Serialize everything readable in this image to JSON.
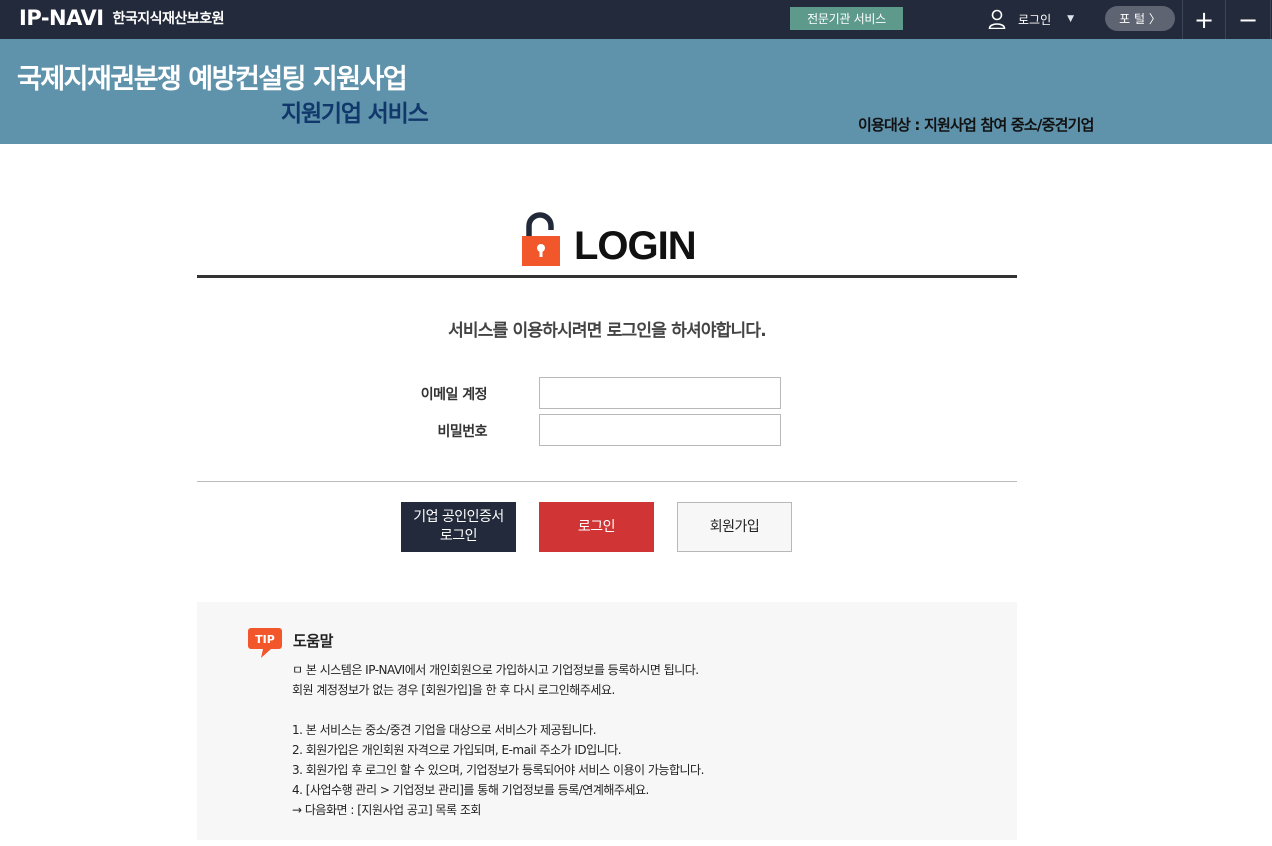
{
  "topbar": {
    "logo_text": "IP-NAVI",
    "org_name": "한국지식재산보호원",
    "expert_service_label": "전문기관 서비스",
    "login_label": "로그인",
    "portal_label": "포 털 〉",
    "zoom_in_symbol": "+",
    "zoom_out_symbol": "−"
  },
  "banner": {
    "title": "국제지재권분쟁 예방컨설팅 지원사업",
    "subtitle": "지원기업 서비스",
    "target_text": "이용대상 : 지원사업 참여 중소/중견기업"
  },
  "login": {
    "heading": "LOGIN",
    "notice": "서비스를 이용하시려면 로그인을 하셔야합니다.",
    "email_label": "이메일 계정",
    "email_value": "",
    "password_label": "비밀번호",
    "password_value": "",
    "cert_button_line1": "기업 공인인증서",
    "cert_button_line2": "로그인",
    "login_button": "로그인",
    "join_button": "회원가입"
  },
  "help": {
    "badge": "TIP",
    "title": "도움말",
    "lines": [
      "ㅁ 본 시스템은 IP-NAVI에서 개인회원으로 가입하시고 기업정보를 등록하시면 됩니다.",
      "회원 계정정보가 없는 경우 [회원가입]을 한 후 다시 로그인해주세요.",
      "",
      "1. 본 서비스는 중소/중견 기업을 대상으로 서비스가 제공됩니다.",
      "2. 회원가입은 개인회원 자격으로 가입되며, E-mail 주소가 ID입니다.",
      "3. 회원가입 후 로그인 할 수 있으며, 기업정보가 등록되어야 서비스 이용이 가능합니다.",
      "4. [사업수행 관리 > 기업정보 관리]를 통해 기업정보를 등록/연계해주세요.",
      "→ 다음화면 : [지원사업 공고] 목록 조회"
    ]
  },
  "colors": {
    "topbar_bg": "#232a3b",
    "banner_bg": "#5f92ab",
    "subtitle_navy": "#10386a",
    "expert_green": "#5d9a8c",
    "login_red": "#d13434",
    "lock_orange": "#f2572b",
    "tip_orange": "#f2572b"
  },
  "icons": {
    "user": "user-icon",
    "lock": "lock-open-icon",
    "tip": "tip-bubble-icon"
  }
}
